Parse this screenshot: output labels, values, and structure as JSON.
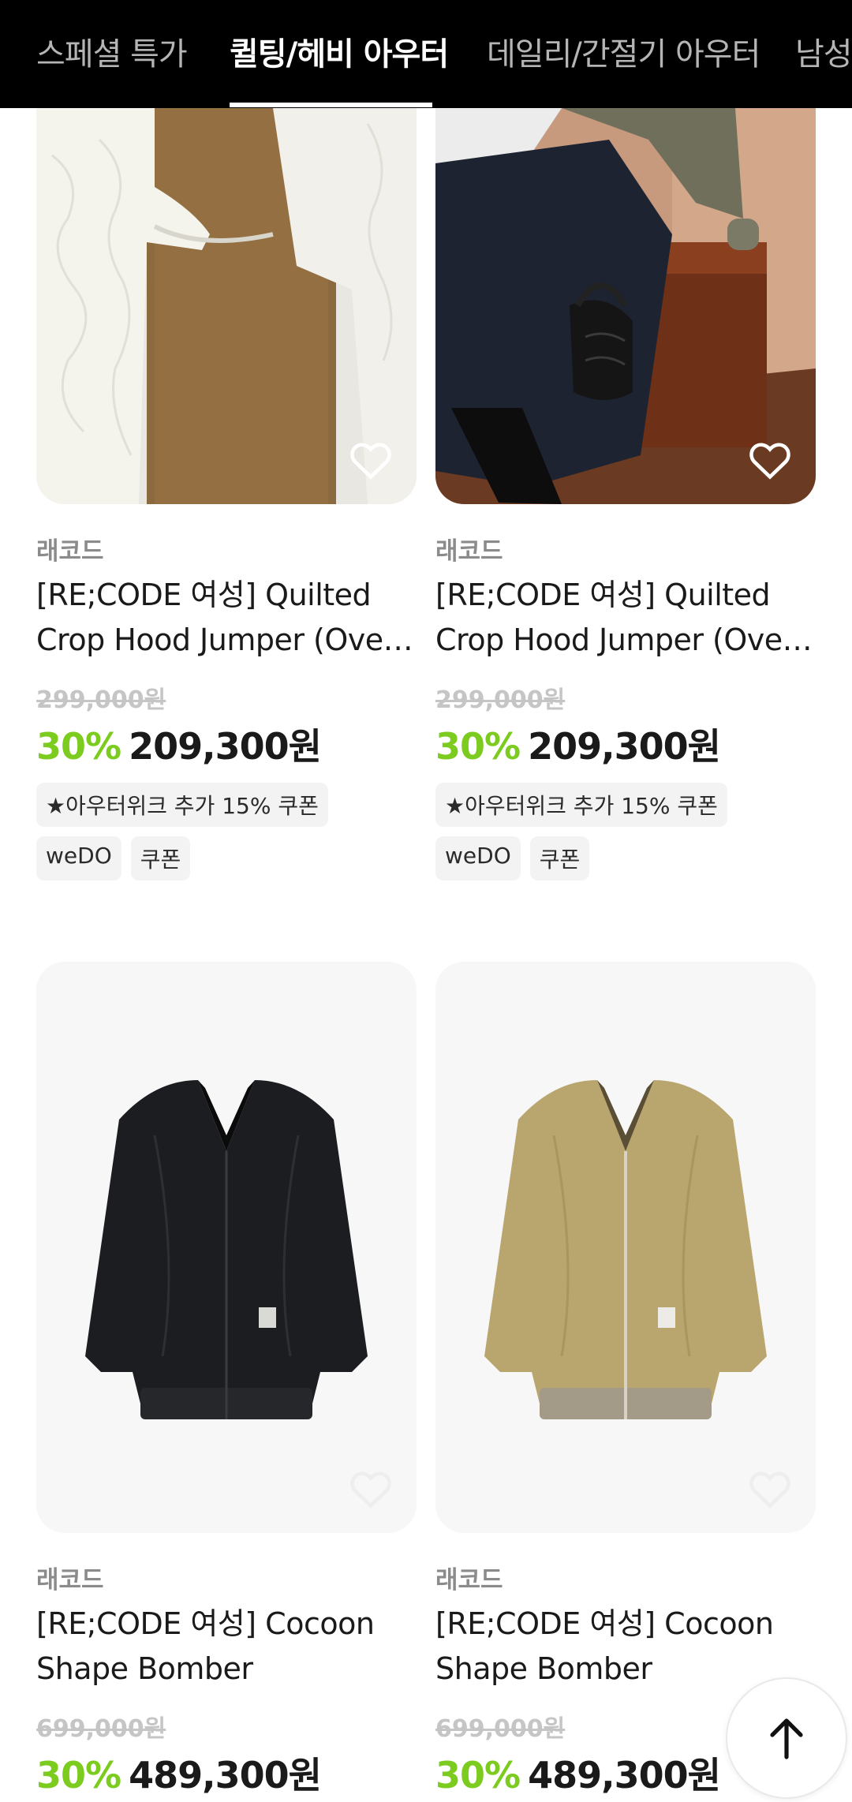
{
  "tabs": [
    {
      "label": "스페셜 특가",
      "active": false
    },
    {
      "label": "퀼팅/헤비 아우터",
      "active": true
    },
    {
      "label": "데일리/간절기 아우터",
      "active": false
    },
    {
      "label": "남성",
      "active": false
    }
  ],
  "products": [
    {
      "brand": "래코드",
      "name_line1": "[RE;CODE 여성] Quilted",
      "name_line2": "Crop Hood Jumper (Over...",
      "original_price": "299,000원",
      "discount": "30%",
      "price": "209,300원",
      "coupon": "★아우터위크 추가 15% 쿠폰",
      "tags": [
        "weDO",
        "쿠폰"
      ],
      "image": "cream-quilted-jacket-photo"
    },
    {
      "brand": "래코드",
      "name_line1": "[RE;CODE 여성] Quilted",
      "name_line2": "Crop Hood Jumper (Over...",
      "original_price": "299,000원",
      "discount": "30%",
      "price": "209,300원",
      "coupon": "★아우터위크 추가 15% 쿠폰",
      "tags": [
        "weDO",
        "쿠폰"
      ],
      "image": "model-khaki-jacket-photo"
    },
    {
      "brand": "래코드",
      "name_line1": "[RE;CODE 여성] Cocoon",
      "name_line2": "Shape Bomber",
      "original_price": "699,000원",
      "discount": "30%",
      "price": "489,300원",
      "image": "black-bomber-photo"
    },
    {
      "brand": "래코드",
      "name_line1": "[RE;CODE 여성] Cocoon",
      "name_line2": "Shape Bomber",
      "original_price": "699,000원",
      "discount": "30%",
      "price": "489,300원",
      "image": "beige-bomber-photo"
    }
  ],
  "colors": {
    "discount": "#7ccb1f",
    "tabbar": "#000000"
  },
  "icons": {
    "wishlist": "heart-icon",
    "scroll_top": "arrow-up-icon"
  }
}
